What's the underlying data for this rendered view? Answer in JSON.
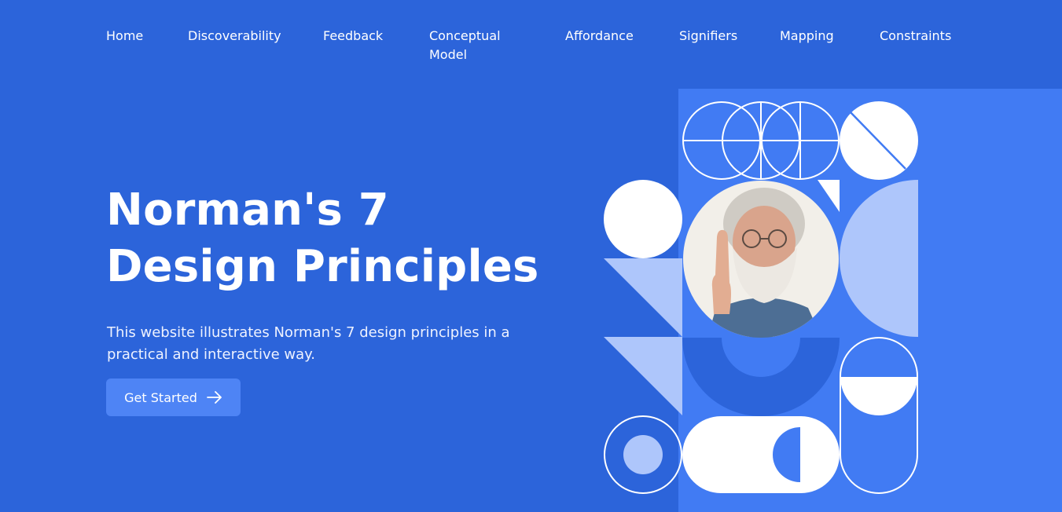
{
  "nav": {
    "items": [
      {
        "label": "Home"
      },
      {
        "label": "Discoverability"
      },
      {
        "label": "Feedback"
      },
      {
        "label": "Conceptual Model"
      },
      {
        "label": "Affordance"
      },
      {
        "label": "Signifiers"
      },
      {
        "label": "Mapping"
      },
      {
        "label": "Constraints"
      }
    ]
  },
  "hero": {
    "title_line1": "Norman's 7",
    "title_line2": "Design Principles",
    "description": "This website illustrates Norman's 7 design principles in a practical and interactive way.",
    "cta_label": "Get Started",
    "cta_icon": "arrow-right-icon"
  },
  "colors": {
    "background": "#2c64da",
    "panel": "#417bf3",
    "button": "#4e84f5",
    "light_shape": "#aec6fb",
    "white": "#ffffff"
  }
}
